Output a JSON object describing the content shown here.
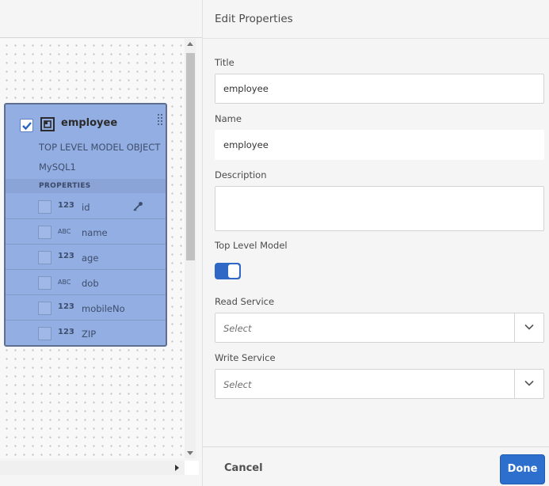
{
  "canvas": {
    "model": {
      "title": "employee",
      "subtitle": "TOP LEVEL MODEL OBJECT",
      "source": "MySQL1",
      "properties_header": "PROPERTIES",
      "properties": [
        {
          "type": "123",
          "name": "id",
          "is_key": true
        },
        {
          "type": "ABC",
          "name": "name"
        },
        {
          "type": "123",
          "name": "age"
        },
        {
          "type": "ABC",
          "name": "dob"
        },
        {
          "type": "123",
          "name": "mobileNo"
        },
        {
          "type": "123",
          "name": "ZIP"
        }
      ]
    }
  },
  "panel": {
    "title": "Edit Properties",
    "fields": {
      "title_label": "Title",
      "title_value": "employee",
      "name_label": "Name",
      "name_value": "employee",
      "description_label": "Description",
      "description_value": "",
      "top_level_label": "Top Level Model",
      "top_level_on": true,
      "read_service_label": "Read Service",
      "read_service_placeholder": "Select",
      "write_service_label": "Write Service",
      "write_service_placeholder": "Select"
    },
    "footer": {
      "cancel_label": "Cancel",
      "done_label": "Done"
    }
  },
  "colors": {
    "accent": "#2c6fcd",
    "card_bg": "#93aee2"
  }
}
